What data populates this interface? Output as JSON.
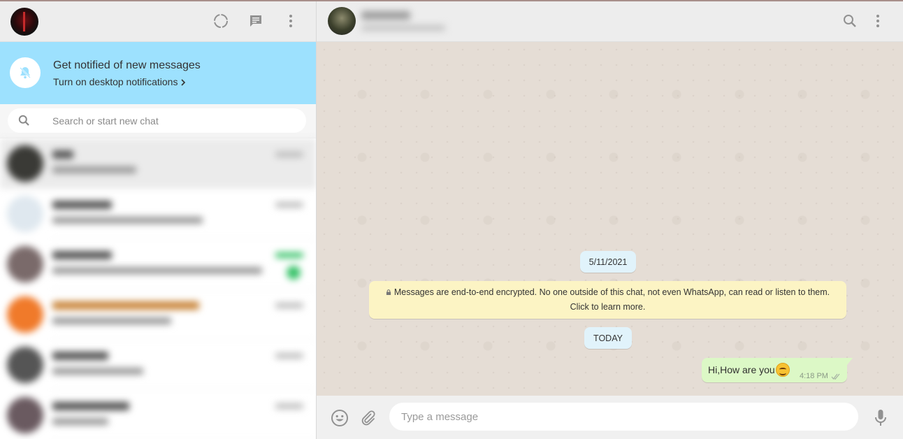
{
  "colors": {
    "accent_notification": "#9de1fe",
    "outgoing_bubble": "#dcf8c6",
    "system_chip": "#e1f3fb",
    "encryption_notice": "#fcf4c4"
  },
  "sidebar": {
    "icons": [
      "status-icon",
      "new-chat-icon",
      "menu-icon"
    ],
    "notification": {
      "title": "Get notified of new messages",
      "link": "Turn on desktop notifications"
    },
    "search": {
      "placeholder": "Search or start new chat"
    }
  },
  "conversation": {
    "date_label": "5/11/2021",
    "encryption_notice_line1": "Messages are end-to-end encrypted. No one outside of this chat, not even WhatsApp, can read or listen to them.",
    "encryption_notice_line2": "Click to learn more.",
    "today_label": "TODAY",
    "messages": [
      {
        "text": "Hi,How are you",
        "emoji": "smiling-face",
        "time": "4:18 PM",
        "status": "read"
      }
    ]
  },
  "composer": {
    "placeholder": "Type a message"
  }
}
